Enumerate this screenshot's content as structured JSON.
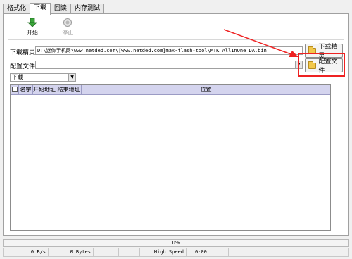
{
  "tabs": [
    {
      "label": "格式化",
      "active": false
    },
    {
      "label": "下载",
      "active": true
    },
    {
      "label": "回读",
      "active": false
    },
    {
      "label": "内存测试",
      "active": false
    }
  ],
  "toolbar": {
    "start_label": "开始",
    "stop_label": "停止"
  },
  "download_agent": {
    "label": "下载精灵",
    "value": "D:\\迷你手机网\\www.netded.com\\[www.netded.com]max-flash-tool\\MTK_AllInOne_DA.bin",
    "button_label": "下载精灵"
  },
  "config_file": {
    "label": "配置文件",
    "value": "",
    "button_label": "配置文件"
  },
  "mode_select": {
    "value": "下载"
  },
  "table": {
    "columns": [
      "名字",
      "开始地址",
      "结束地址",
      "位置"
    ],
    "rows": []
  },
  "status": {
    "progress_text": "0%",
    "progress": 0,
    "speed": "0 B/s",
    "bytes": "0 Bytes",
    "usb_mode": "High Speed",
    "time": "0:00"
  },
  "colors": {
    "annotation": "#ee2222",
    "header": "#d4d4ee",
    "folder": "#f2c84b"
  }
}
